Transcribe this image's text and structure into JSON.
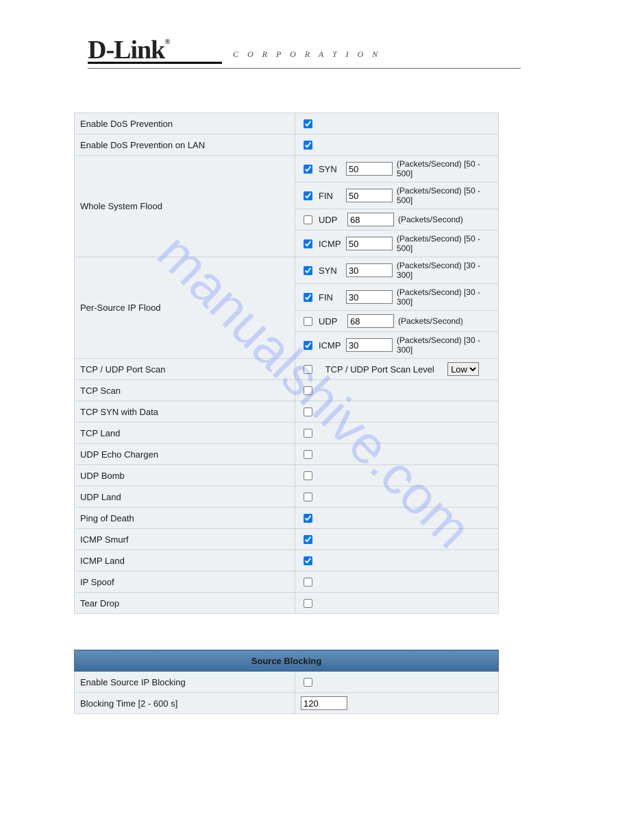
{
  "header": {
    "brand": "D-Link",
    "reg": "®",
    "corp": "C O R P O R A T I O N"
  },
  "watermark": "manualshive.com",
  "rows": {
    "enable_dos": "Enable DoS Prevention",
    "enable_dos_lan": "Enable DoS Prevention on LAN",
    "whole_sys": "Whole System Flood",
    "per_src": "Per-Source IP Flood",
    "tcpudp_scan": "TCP / UDP Port Scan",
    "tcp_scan": "TCP Scan",
    "tcp_syn_data": "TCP SYN with Data",
    "tcp_land": "TCP Land",
    "udp_echo": "UDP Echo Chargen",
    "udp_bomb": "UDP Bomb",
    "udp_land": "UDP Land",
    "ping_death": "Ping of Death",
    "icmp_smurf": "ICMP Smurf",
    "icmp_land": "ICMP Land",
    "ip_spoof": "IP Spoof",
    "tear_drop": "Tear Drop"
  },
  "flood_proto": {
    "syn": "SYN",
    "fin": "FIN",
    "udp": "UDP",
    "icmp": "ICMP"
  },
  "whole_sys": {
    "syn_val": "50",
    "syn_range": "(Packets/Second) [50 - 500]",
    "fin_val": "50",
    "fin_range": "(Packets/Second) [50 - 500]",
    "udp_val": "68",
    "udp_range": "(Packets/Second)",
    "icmp_val": "50",
    "icmp_range": "(Packets/Second) [50 - 500]"
  },
  "per_src": {
    "syn_val": "30",
    "syn_range": "(Packets/Second) [30 - 300]",
    "fin_val": "30",
    "fin_range": "(Packets/Second) [30 - 300]",
    "udp_val": "68",
    "udp_range": "(Packets/Second)",
    "icmp_val": "30",
    "icmp_range": "(Packets/Second) [30 - 300]"
  },
  "port_scan": {
    "label": "TCP / UDP Port Scan Level",
    "value": "Low"
  },
  "source_blocking": {
    "header": "Source Blocking",
    "enable": "Enable Source IP Blocking",
    "time_label": "Blocking Time [2 - 600 s]",
    "time_value": "120"
  }
}
